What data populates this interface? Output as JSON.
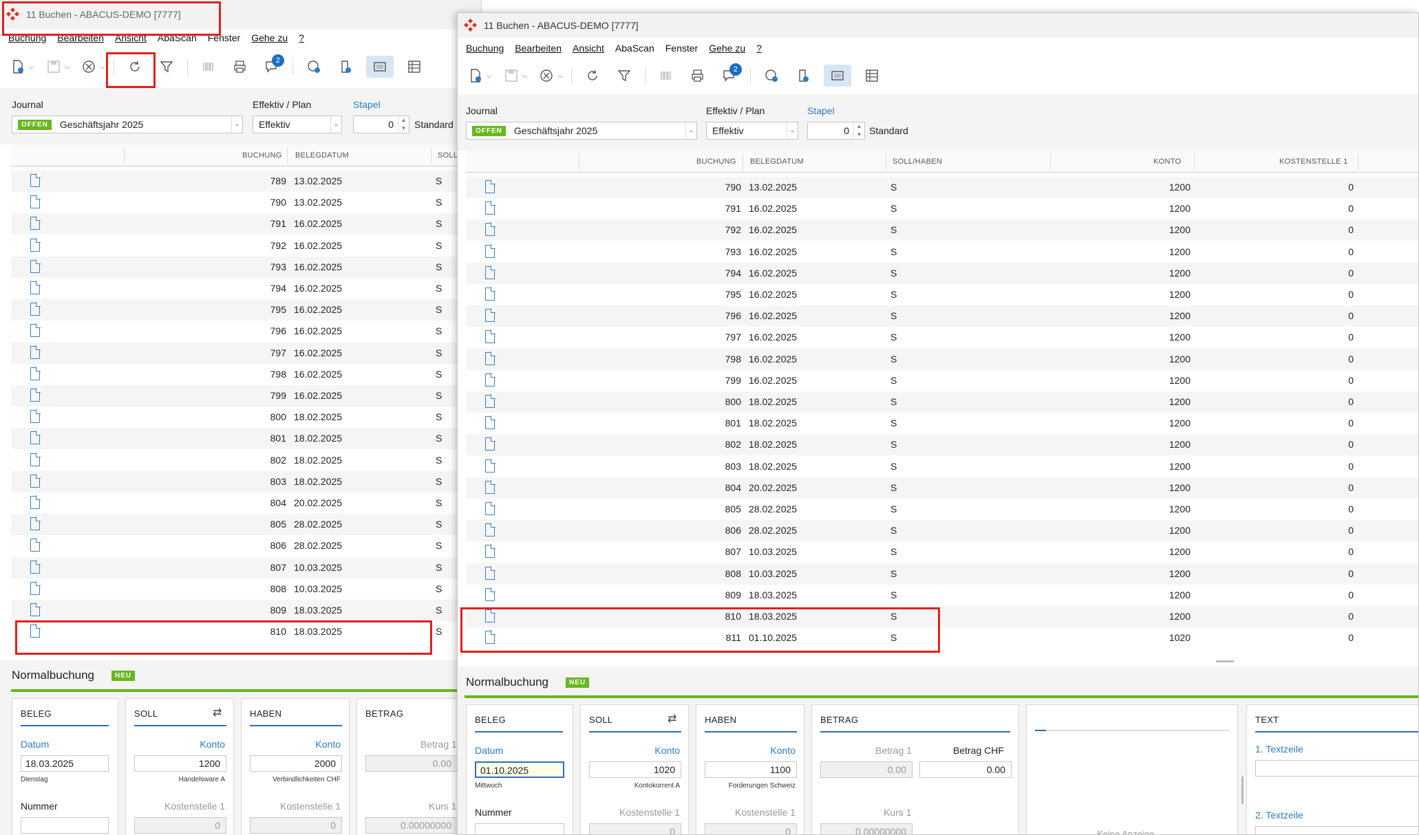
{
  "colors": {
    "accent": "#2d7cc4",
    "highlight": "#e02020",
    "status_green": "#67b71f"
  },
  "windowA": {
    "title": "11 Buchen - ABACUS-DEMO [7777]",
    "menu": [
      "Buchung",
      "Bearbeiten",
      "Ansicht",
      "AbaScan",
      "Fenster",
      "Gehe zu",
      "?"
    ],
    "toolbar_badge": "2",
    "filters": {
      "journal_label": "Journal",
      "status": "OFFEN",
      "journal_value": "Geschäftsjahr 2025",
      "effektiv_label": "Effektiv / Plan",
      "effektiv_value": "Effektiv",
      "stapel_label": "Stapel",
      "stapel_value": "0",
      "standard": "Standard"
    },
    "columns": [
      "BUCHUNG",
      "BELEGDATUM",
      "SOLL"
    ],
    "rows": [
      {
        "nr": "789",
        "date": "13.02.2025",
        "sh": "S"
      },
      {
        "nr": "790",
        "date": "13.02.2025",
        "sh": "S"
      },
      {
        "nr": "791",
        "date": "16.02.2025",
        "sh": "S"
      },
      {
        "nr": "792",
        "date": "16.02.2025",
        "sh": "S"
      },
      {
        "nr": "793",
        "date": "16.02.2025",
        "sh": "S"
      },
      {
        "nr": "794",
        "date": "16.02.2025",
        "sh": "S"
      },
      {
        "nr": "795",
        "date": "16.02.2025",
        "sh": "S"
      },
      {
        "nr": "796",
        "date": "16.02.2025",
        "sh": "S"
      },
      {
        "nr": "797",
        "date": "16.02.2025",
        "sh": "S"
      },
      {
        "nr": "798",
        "date": "16.02.2025",
        "sh": "S"
      },
      {
        "nr": "799",
        "date": "16.02.2025",
        "sh": "S"
      },
      {
        "nr": "800",
        "date": "18.02.2025",
        "sh": "S"
      },
      {
        "nr": "801",
        "date": "18.02.2025",
        "sh": "S"
      },
      {
        "nr": "802",
        "date": "18.02.2025",
        "sh": "S"
      },
      {
        "nr": "803",
        "date": "18.02.2025",
        "sh": "S"
      },
      {
        "nr": "804",
        "date": "20.02.2025",
        "sh": "S"
      },
      {
        "nr": "805",
        "date": "28.02.2025",
        "sh": "S"
      },
      {
        "nr": "806",
        "date": "28.02.2025",
        "sh": "S"
      },
      {
        "nr": "807",
        "date": "10.03.2025",
        "sh": "S"
      },
      {
        "nr": "808",
        "date": "10.03.2025",
        "sh": "S"
      },
      {
        "nr": "809",
        "date": "18.03.2025",
        "sh": "S"
      },
      {
        "nr": "810",
        "date": "18.03.2025",
        "sh": "S"
      }
    ],
    "form": {
      "title": "Normalbuchung",
      "neu": "NEU",
      "beleg": {
        "header": "BELEG",
        "datum_label": "Datum",
        "datum": "18.03.2025",
        "weekday": "Dienstag",
        "nummer_label": "Nummer"
      },
      "soll": {
        "header": "SOLL",
        "konto_label": "Konto",
        "konto": "1200",
        "konto_name": "Handelsware A",
        "kst_label": "Kostenstelle 1",
        "kst": "0"
      },
      "haben": {
        "header": "HABEN",
        "konto_label": "Konto",
        "konto": "2000",
        "konto_name": "Verbindlichkeiten CHF",
        "kst_label": "Kostenstelle 1",
        "kst": "0"
      },
      "betrag": {
        "header": "BETRAG",
        "betrag1_label": "Betrag 1",
        "betrag1": "0.00",
        "kurs_label": "Kurs 1",
        "kurs": "0.00000000"
      }
    }
  },
  "windowB": {
    "title": "11 Buchen - ABACUS-DEMO [7777]",
    "menu": [
      "Buchung",
      "Bearbeiten",
      "Ansicht",
      "AbaScan",
      "Fenster",
      "Gehe zu",
      "?"
    ],
    "toolbar_badge": "2",
    "filters": {
      "journal_label": "Journal",
      "status": "OFFEN",
      "journal_value": "Geschäftsjahr 2025",
      "effektiv_label": "Effektiv / Plan",
      "effektiv_value": "Effektiv",
      "stapel_label": "Stapel",
      "stapel_value": "0",
      "standard": "Standard"
    },
    "columns": [
      "BUCHUNG",
      "BELEGDATUM",
      "SOLL/HABEN",
      "KONTO",
      "KOSTENSTELLE 1"
    ],
    "rows": [
      {
        "nr": "790",
        "date": "13.02.2025",
        "sh": "S",
        "konto": "1200",
        "kst": "0"
      },
      {
        "nr": "791",
        "date": "16.02.2025",
        "sh": "S",
        "konto": "1200",
        "kst": "0"
      },
      {
        "nr": "792",
        "date": "16.02.2025",
        "sh": "S",
        "konto": "1200",
        "kst": "0"
      },
      {
        "nr": "793",
        "date": "16.02.2025",
        "sh": "S",
        "konto": "1200",
        "kst": "0"
      },
      {
        "nr": "794",
        "date": "16.02.2025",
        "sh": "S",
        "konto": "1200",
        "kst": "0"
      },
      {
        "nr": "795",
        "date": "16.02.2025",
        "sh": "S",
        "konto": "1200",
        "kst": "0"
      },
      {
        "nr": "796",
        "date": "16.02.2025",
        "sh": "S",
        "konto": "1200",
        "kst": "0"
      },
      {
        "nr": "797",
        "date": "16.02.2025",
        "sh": "S",
        "konto": "1200",
        "kst": "0"
      },
      {
        "nr": "798",
        "date": "16.02.2025",
        "sh": "S",
        "konto": "1200",
        "kst": "0"
      },
      {
        "nr": "799",
        "date": "16.02.2025",
        "sh": "S",
        "konto": "1200",
        "kst": "0"
      },
      {
        "nr": "800",
        "date": "18.02.2025",
        "sh": "S",
        "konto": "1200",
        "kst": "0"
      },
      {
        "nr": "801",
        "date": "18.02.2025",
        "sh": "S",
        "konto": "1200",
        "kst": "0"
      },
      {
        "nr": "802",
        "date": "18.02.2025",
        "sh": "S",
        "konto": "1200",
        "kst": "0"
      },
      {
        "nr": "803",
        "date": "18.02.2025",
        "sh": "S",
        "konto": "1200",
        "kst": "0"
      },
      {
        "nr": "804",
        "date": "20.02.2025",
        "sh": "S",
        "konto": "1200",
        "kst": "0"
      },
      {
        "nr": "805",
        "date": "28.02.2025",
        "sh": "S",
        "konto": "1200",
        "kst": "0"
      },
      {
        "nr": "806",
        "date": "28.02.2025",
        "sh": "S",
        "konto": "1200",
        "kst": "0"
      },
      {
        "nr": "807",
        "date": "10.03.2025",
        "sh": "S",
        "konto": "1200",
        "kst": "0"
      },
      {
        "nr": "808",
        "date": "10.03.2025",
        "sh": "S",
        "konto": "1200",
        "kst": "0"
      },
      {
        "nr": "809",
        "date": "18.03.2025",
        "sh": "S",
        "konto": "1200",
        "kst": "0"
      },
      {
        "nr": "810",
        "date": "18.03.2025",
        "sh": "S",
        "konto": "1200",
        "kst": "0"
      },
      {
        "nr": "811",
        "date": "01.10.2025",
        "sh": "S",
        "konto": "1020",
        "kst": "0"
      }
    ],
    "form": {
      "title": "Normalbuchung",
      "neu": "NEU",
      "beleg": {
        "header": "BELEG",
        "datum_label": "Datum",
        "datum": "01.10.2025",
        "weekday": "Mittwoch",
        "nummer_label": "Nummer"
      },
      "soll": {
        "header": "SOLL",
        "konto_label": "Konto",
        "konto": "1020",
        "konto_name": "Kontokorrent A",
        "kst_label": "Kostenstelle 1",
        "kst": "0"
      },
      "haben": {
        "header": "HABEN",
        "konto_label": "Konto",
        "konto": "1100",
        "konto_name": "Forderungen Schweiz",
        "kst_label": "Kostenstelle 1",
        "kst": "0"
      },
      "betrag": {
        "header": "BETRAG",
        "betrag1_label": "Betrag 1",
        "betrag1": "0.00",
        "betrag_chf_label": "Betrag CHF",
        "betrag_chf": "0.00",
        "kurs_label": "Kurs 1",
        "kurs": "0.00000000"
      },
      "preview": {
        "text": "Keine Anzeige"
      },
      "text": {
        "header": "TEXT",
        "line1_label": "1. Textzeile",
        "line2_label": "2. Textzeile"
      }
    }
  }
}
